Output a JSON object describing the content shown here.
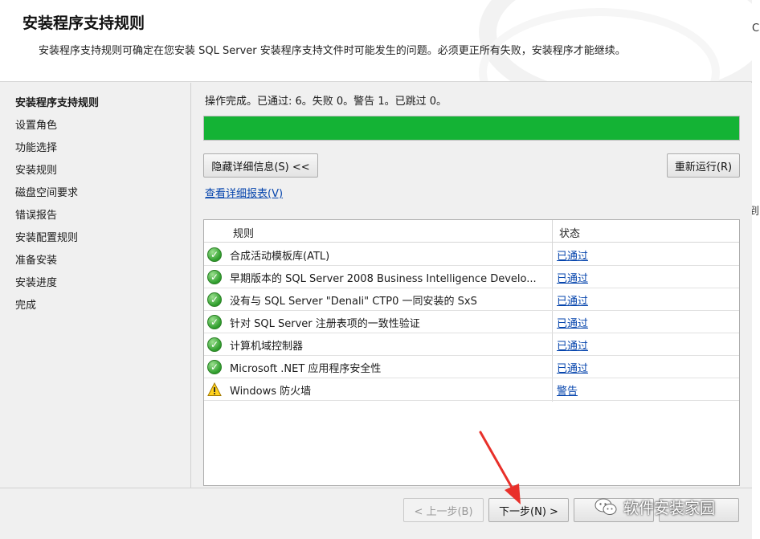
{
  "header": {
    "title": "安装程序支持规则",
    "description": "安装程序支持规则可确定在您安装 SQL Server 安装程序支持文件时可能发生的问题。必须更正所有失败，安装程序才能继续。"
  },
  "sidebar": {
    "items": [
      {
        "label": "安装程序支持规则",
        "active": true
      },
      {
        "label": "设置角色"
      },
      {
        "label": "功能选择"
      },
      {
        "label": "安装规则"
      },
      {
        "label": "磁盘空间要求"
      },
      {
        "label": "错误报告"
      },
      {
        "label": "安装配置规则"
      },
      {
        "label": "准备安装"
      },
      {
        "label": "安装进度"
      },
      {
        "label": "完成"
      }
    ]
  },
  "main": {
    "status": "操作完成。已通过: 6。失败 0。警告 1。已跳过 0。",
    "progress": 1.0,
    "progress_color": "#14b335",
    "hide_details_button": "隐藏详细信息(S) <<",
    "rerun_button": "重新运行(R)",
    "view_report_link": "查看详细报表(V)",
    "table": {
      "headers": [
        "规则",
        "状态"
      ],
      "rows": [
        {
          "rule": "合成活动模板库(ATL)",
          "status": "已通过",
          "icon": "check-icon"
        },
        {
          "rule": "早期版本的 SQL Server 2008 Business Intelligence Develo...",
          "status": "已通过",
          "icon": "check-icon"
        },
        {
          "rule": "没有与 SQL Server \"Denali\" CTP0 一同安装的 SxS",
          "status": "已通过",
          "icon": "check-icon"
        },
        {
          "rule": "针对 SQL Server 注册表项的一致性验证",
          "status": "已通过",
          "icon": "check-icon"
        },
        {
          "rule": "计算机域控制器",
          "status": "已通过",
          "icon": "check-icon"
        },
        {
          "rule": "Microsoft .NET 应用程序安全性",
          "status": "已通过",
          "icon": "check-icon"
        },
        {
          "rule": "Windows 防火墙",
          "status": "警告",
          "icon": "warning-icon"
        }
      ]
    }
  },
  "footer": {
    "back_button": "< 上一步(B)",
    "next_button": "下一步(N) >"
  },
  "edge": {
    "char1": "C",
    "char2": "到"
  },
  "watermark": {
    "text": "软件安装家园"
  }
}
